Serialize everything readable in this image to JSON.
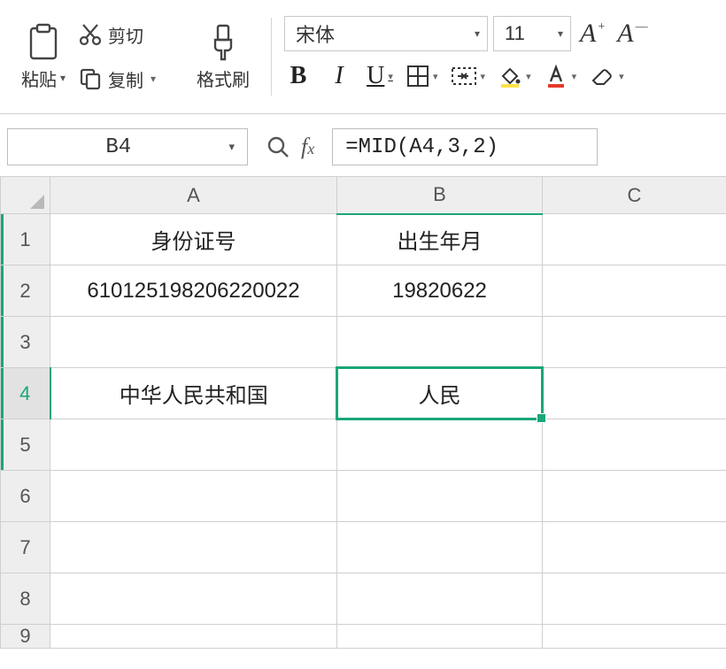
{
  "ribbon": {
    "paste_label": "粘贴",
    "cut_label": "剪切",
    "copy_label": "复制",
    "format_painter_label": "格式刷",
    "font_name": "宋体",
    "font_size": "11"
  },
  "namebox": {
    "ref": "B4"
  },
  "formula_bar": {
    "value": "=MID(A4,3,2)"
  },
  "columns": [
    "A",
    "B",
    "C"
  ],
  "rows": [
    "1",
    "2",
    "3",
    "4",
    "5",
    "6",
    "7",
    "8",
    "9"
  ],
  "active": {
    "col": "B",
    "row": "4"
  },
  "cells": {
    "A1": "身份证号",
    "B1": "出生年月",
    "A2": "610125198206220022",
    "B2": "19820622",
    "A4": "中华人民共和国",
    "B4": "人民"
  }
}
